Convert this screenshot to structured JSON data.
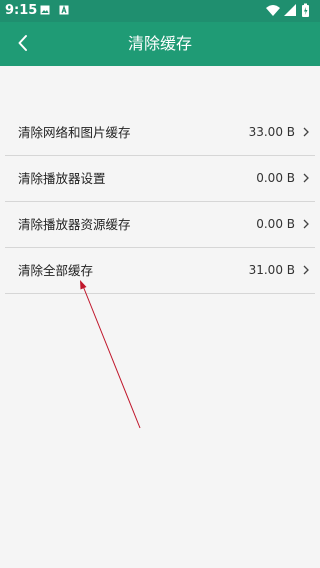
{
  "status_bar": {
    "time": "9:15",
    "icons_left": [
      "image-icon",
      "font-icon"
    ],
    "icons_right": [
      "wifi-icon",
      "signal-icon",
      "battery-icon"
    ],
    "color": "#1f8f6f"
  },
  "app_bar": {
    "title": "清除缓存",
    "back_icon": "back-chevron-icon",
    "color": "#1f9b75"
  },
  "cache_items": [
    {
      "label": "清除网络和图片缓存",
      "value": "33.00 B"
    },
    {
      "label": "清除播放器设置",
      "value": "0.00 B"
    },
    {
      "label": "清除播放器资源缓存",
      "value": "0.00 B"
    },
    {
      "label": "清除全部缓存",
      "value": "31.00 B"
    }
  ],
  "annotation": {
    "color": "#c0152a"
  }
}
